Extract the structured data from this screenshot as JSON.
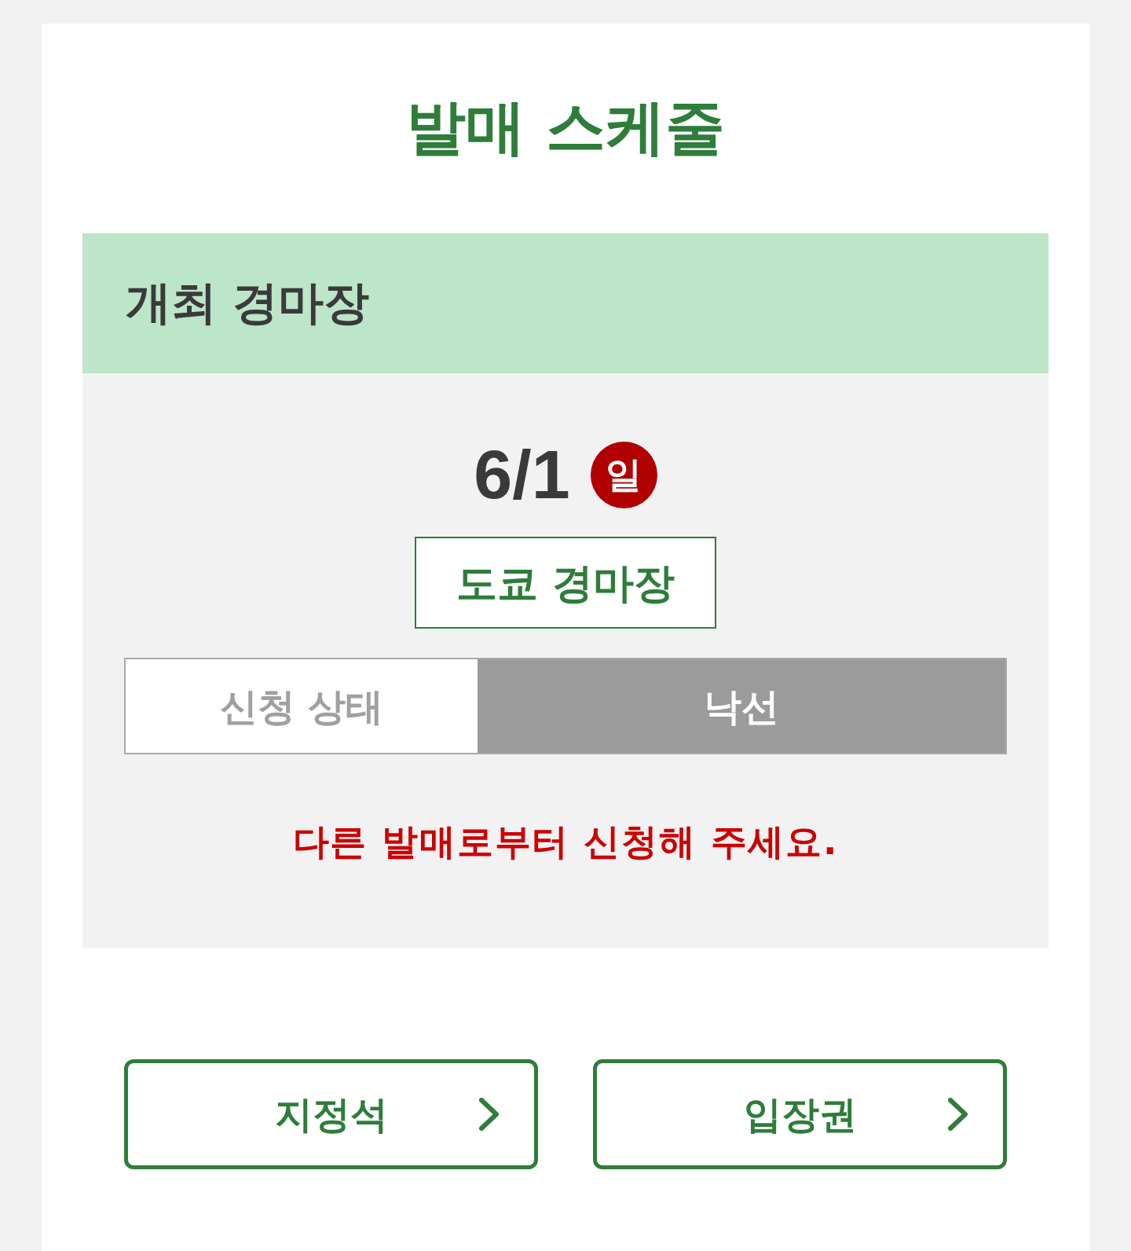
{
  "title": "발매 스케줄",
  "venue_section": {
    "heading": "개최 경마장",
    "date": "6/1",
    "weekday": "일",
    "venue": "도쿄 경마장",
    "status": {
      "label": "신청 상태",
      "value": "낙선"
    },
    "message": "다른 발매로부터 신청해 주세요."
  },
  "buttons": [
    {
      "label": "지정석"
    },
    {
      "label": "입장권"
    }
  ]
}
